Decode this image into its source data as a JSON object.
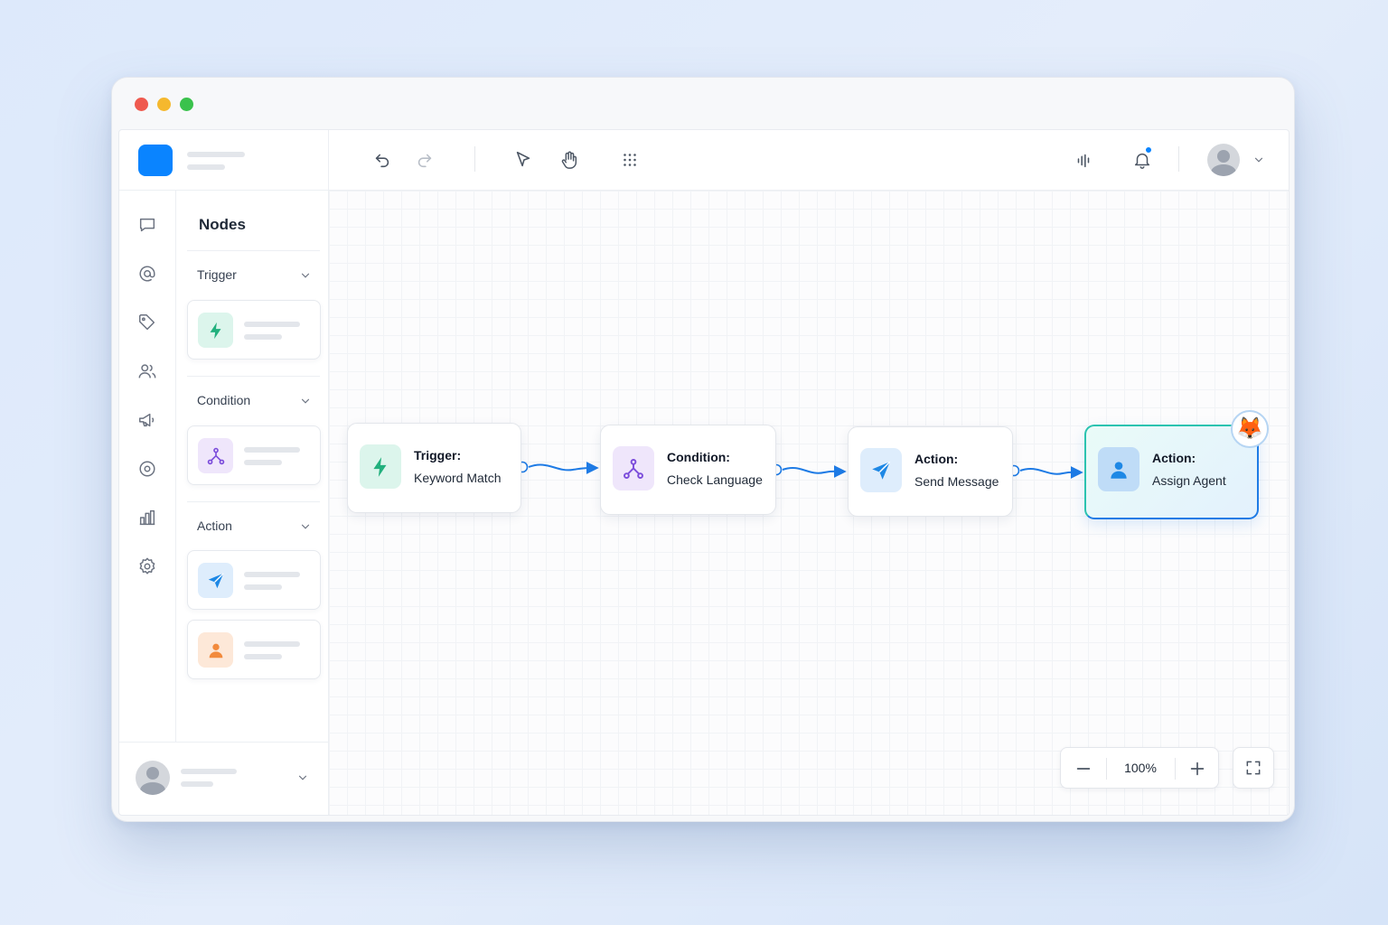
{
  "window": {
    "controls": [
      "close",
      "minimize",
      "maximize"
    ]
  },
  "toolbar": {
    "icons": [
      "undo-icon",
      "redo-icon",
      "pointer-icon",
      "hand-icon",
      "grid-dots-icon",
      "activity-icon",
      "bell-icon",
      "avatar",
      "chevron-down-icon"
    ],
    "has_notification": true
  },
  "rail": {
    "icons": [
      "chat-icon",
      "at-sign-icon",
      "tag-icon",
      "users-icon",
      "megaphone-icon",
      "gear-outline-icon",
      "bar-chart-icon",
      "settings-icon"
    ]
  },
  "nodes_panel": {
    "title": "Nodes",
    "groups": [
      {
        "label": "Trigger",
        "cards": [
          {
            "icon": "lightning-icon"
          }
        ]
      },
      {
        "label": "Condition",
        "cards": [
          {
            "icon": "branch-icon"
          }
        ]
      },
      {
        "label": "Action",
        "cards": [
          {
            "icon": "send-icon"
          },
          {
            "icon": "person-icon"
          }
        ]
      }
    ]
  },
  "flow": {
    "nodes": [
      {
        "line1": "Trigger:",
        "line2": "Keyword Match",
        "icon": "lightning-icon",
        "color": "#22b07d"
      },
      {
        "line1": "Condition:",
        "line2": "Check Language",
        "icon": "branch-icon",
        "color": "#7c4ddb"
      },
      {
        "line1": "Action:",
        "line2": "Send Message",
        "icon": "send-icon",
        "color": "#1e88e5"
      },
      {
        "line1": "Action:",
        "line2": "Assign Agent",
        "icon": "person-icon",
        "color": "#1e88e5",
        "selected": true,
        "badge": "🦊"
      }
    ],
    "edge_color": "#1e7be5"
  },
  "zoom": {
    "value": "100%"
  },
  "colors": {
    "accent": "#0a84ff",
    "trigger": "#22b07d",
    "condition": "#7c4ddb",
    "action": "#1e88e5",
    "assign": "#f28a3c"
  }
}
